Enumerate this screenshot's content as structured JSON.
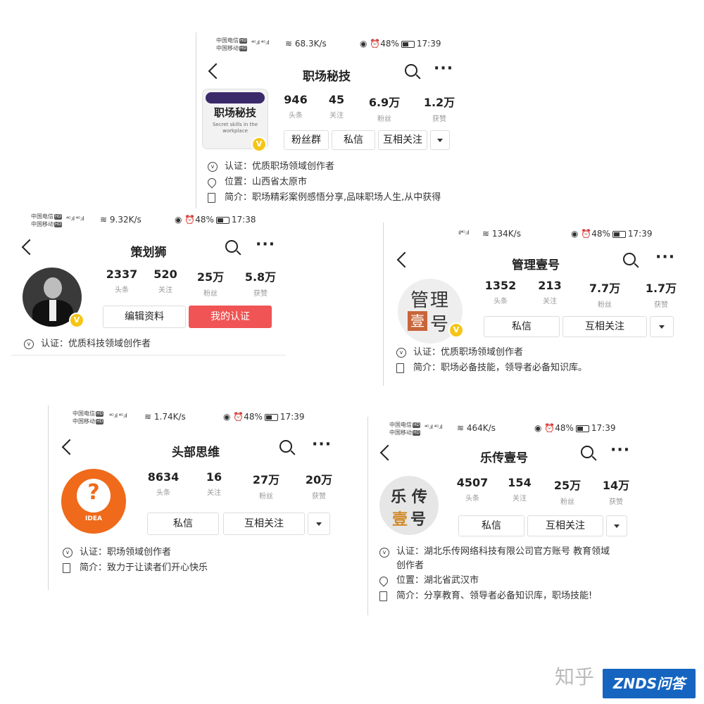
{
  "cards": [
    {
      "status": {
        "carrier1": "中国电信",
        "carrier2": "中国移动",
        "speed": "68.3K/s",
        "battery": "48%",
        "time": "17:39"
      },
      "title": "职场秘技",
      "avatar_text": "职场秘技",
      "avatar_sub": "Secret skills in the workplace",
      "stats": [
        {
          "n": "946",
          "l": "头条"
        },
        {
          "n": "45",
          "l": "关注"
        },
        {
          "n": "6.9万",
          "l": "粉丝"
        },
        {
          "n": "1.2万",
          "l": "获赞"
        }
      ],
      "buttons": [
        "粉丝群",
        "私信",
        "互相关注"
      ],
      "info": [
        {
          "label": "认证：",
          "value": "优质职场领域创作者"
        },
        {
          "label": "位置：",
          "value": "山西省太原市"
        },
        {
          "label": "简介：",
          "value": "职场精彩案例感悟分享,品味职场人生,从中获得"
        }
      ]
    },
    {
      "status": {
        "carrier1": "中国电信",
        "carrier2": "中国移动",
        "speed": "9.32K/s",
        "battery": "48%",
        "time": "17:38"
      },
      "title": "策划狮",
      "stats": [
        {
          "n": "2337",
          "l": "头条"
        },
        {
          "n": "520",
          "l": "关注"
        },
        {
          "n": "25万",
          "l": "粉丝"
        },
        {
          "n": "5.8万",
          "l": "获赞"
        }
      ],
      "buttons": [
        "编辑资料",
        "我的认证"
      ],
      "info": [
        {
          "label": "认证：",
          "value": "优质科技领域创作者"
        }
      ]
    },
    {
      "status": {
        "speed": "134K/s",
        "battery": "48%",
        "time": "17:39"
      },
      "title": "管理壹号",
      "avatar_l1": "管理",
      "avatar_l2a": "壹",
      "avatar_l2b": "号",
      "stats": [
        {
          "n": "1352",
          "l": "头条"
        },
        {
          "n": "213",
          "l": "关注"
        },
        {
          "n": "7.7万",
          "l": "粉丝"
        },
        {
          "n": "1.7万",
          "l": "获赞"
        }
      ],
      "buttons": [
        "私信",
        "互相关注"
      ],
      "info": [
        {
          "label": "认证：",
          "value": "优质职场领域创作者"
        },
        {
          "label": "简介：",
          "value": "职场必备技能，领导者必备知识库。"
        }
      ]
    },
    {
      "status": {
        "carrier1": "中国电信",
        "carrier2": "中国移动",
        "speed": "1.74K/s",
        "battery": "48%",
        "time": "17:39"
      },
      "title": "头部思维",
      "avatar_text": "IDEA",
      "stats": [
        {
          "n": "8634",
          "l": "头条"
        },
        {
          "n": "16",
          "l": "关注"
        },
        {
          "n": "27万",
          "l": "粉丝"
        },
        {
          "n": "20万",
          "l": "获赞"
        }
      ],
      "buttons": [
        "私信",
        "互相关注"
      ],
      "info": [
        {
          "label": "认证：",
          "value": "职场领域创作者"
        },
        {
          "label": "简介：",
          "value": "致力于让读者们开心快乐"
        }
      ]
    },
    {
      "status": {
        "carrier1": "中国电信",
        "carrier2": "中国移动",
        "speed": "464K/s",
        "battery": "48%",
        "time": "17:39"
      },
      "title": "乐传壹号",
      "avatar_l1": "乐 传",
      "avatar_l2a": "壹",
      "avatar_l2b": "号",
      "stats": [
        {
          "n": "4507",
          "l": "头条"
        },
        {
          "n": "154",
          "l": "关注"
        },
        {
          "n": "25万",
          "l": "粉丝"
        },
        {
          "n": "14万",
          "l": "获赞"
        }
      ],
      "buttons": [
        "私信",
        "互相关注"
      ],
      "info": [
        {
          "label": "认证：",
          "value": "湖北乐传网络科技有限公司官方账号 教育领域"
        },
        {
          "label": "",
          "value": "创作者"
        },
        {
          "label": "位置：",
          "value": "湖北省武汉市"
        },
        {
          "label": "简介：",
          "value": "分享教育、领导者必备知识库，职场技能!"
        }
      ]
    }
  ],
  "footer": {
    "zhihu": "知乎",
    "znds": "ZNDS问答"
  },
  "colors": {
    "red_button": "#f05454",
    "badge": "#f5c518",
    "orange_avatar": "#ef6a1a",
    "znds_blue": "#1565c0"
  }
}
